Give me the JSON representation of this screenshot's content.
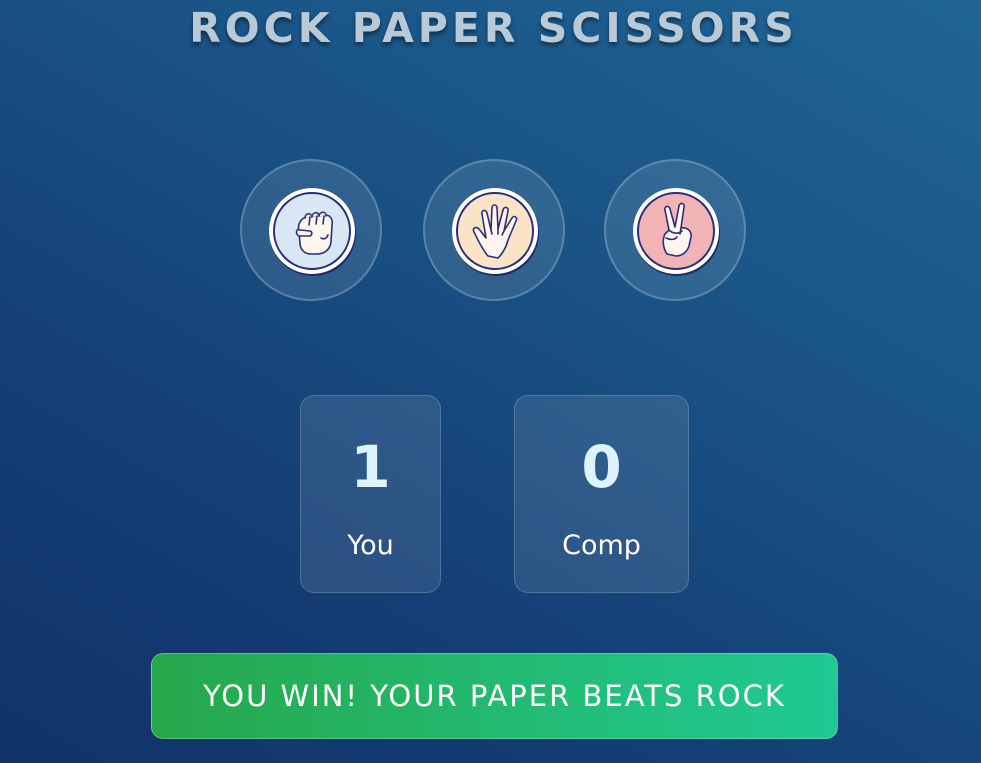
{
  "title": "ROCK PAPER SCISSORS",
  "choices": [
    {
      "id": "rock",
      "icon": "fist-icon",
      "bg": "#d8e6f5"
    },
    {
      "id": "paper",
      "icon": "open-hand-icon",
      "bg": "#fbe3c6"
    },
    {
      "id": "scissors",
      "icon": "peace-hand-icon",
      "bg": "#f2b3b7"
    }
  ],
  "scoreboard": {
    "user": {
      "score": "1",
      "label": "You"
    },
    "computer": {
      "score": "0",
      "label": "Comp"
    }
  },
  "message": "YOU WIN! YOUR PAPER BEATS ROCK",
  "colors": {
    "accent_green": "#22bd78",
    "icon_outline": "#2b2f7a"
  }
}
